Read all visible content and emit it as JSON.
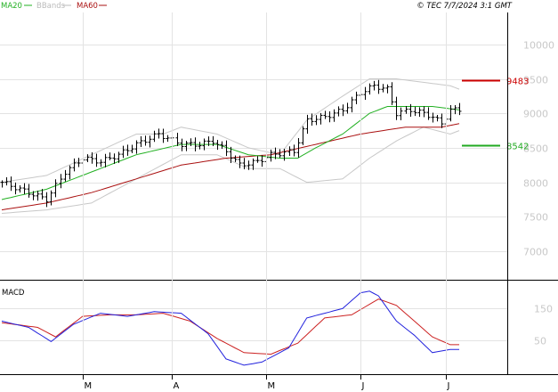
{
  "legend": [
    {
      "label": "MA20",
      "color": "#22b022"
    },
    {
      "label": "BBands",
      "color": "#bbbbbb"
    },
    {
      "label": "MA60",
      "color": "#aa1111"
    }
  ],
  "header_right": "© TEC 7/7/2024 3:1 GMT",
  "macd_title": "MACD",
  "colors": {
    "price_bar": "#000000",
    "ma20": "#22b022",
    "ma60": "#aa1111",
    "bbands": "#c8c8c8",
    "grid": "#e3e3e3",
    "resistance": "#cc0000",
    "support": "#22aa22",
    "macd": "#2222dd",
    "signal": "#cc2222",
    "axis_text": "#c8c8c8"
  },
  "chart_data": [
    {
      "type": "line",
      "title": "",
      "subtitle": "price (OHLC bars) with Bollinger Bands, MA20, MA60",
      "y_ticks": [
        "10000",
        "9500",
        "9000",
        "8500",
        "8000",
        "7500",
        "7000"
      ],
      "y_tick_values": [
        10000,
        9500,
        9000,
        8500,
        8000,
        7500,
        7000
      ],
      "ylim": [
        6600,
        10450
      ],
      "x_ticks": [
        "M",
        "A",
        "M",
        "J",
        "J"
      ],
      "x_tick_index": [
        18,
        38,
        59,
        80,
        99
      ],
      "count": 103,
      "grid": true,
      "levels": [
        {
          "label": "9483",
          "value": 9483,
          "color": "#cc0000"
        },
        {
          "label": "8542",
          "value": 8542,
          "color": "#22aa22"
        }
      ],
      "close_anchors": [
        [
          0,
          8000
        ],
        [
          6,
          7850
        ],
        [
          10,
          7750
        ],
        [
          14,
          8150
        ],
        [
          18,
          8350
        ],
        [
          22,
          8300
        ],
        [
          26,
          8400
        ],
        [
          30,
          8550
        ],
        [
          35,
          8700
        ],
        [
          40,
          8550
        ],
        [
          44,
          8550
        ],
        [
          47,
          8600
        ],
        [
          50,
          8450
        ],
        [
          53,
          8250
        ],
        [
          57,
          8300
        ],
        [
          60,
          8400
        ],
        [
          65,
          8450
        ],
        [
          68,
          8900
        ],
        [
          72,
          8950
        ],
        [
          76,
          9050
        ],
        [
          80,
          9300
        ],
        [
          83,
          9400
        ],
        [
          86,
          9350
        ],
        [
          88,
          9000
        ],
        [
          91,
          9050
        ],
        [
          94,
          9000
        ],
        [
          96,
          8950
        ],
        [
          98,
          8850
        ],
        [
          100,
          9050
        ],
        [
          102,
          9050
        ]
      ],
      "ma20_anchors": [
        [
          0,
          7750
        ],
        [
          10,
          7900
        ],
        [
          20,
          8150
        ],
        [
          30,
          8400
        ],
        [
          40,
          8550
        ],
        [
          48,
          8550
        ],
        [
          55,
          8400
        ],
        [
          62,
          8350
        ],
        [
          66,
          8350
        ],
        [
          70,
          8500
        ],
        [
          76,
          8700
        ],
        [
          82,
          9000
        ],
        [
          86,
          9100
        ],
        [
          90,
          9100
        ],
        [
          96,
          9100
        ],
        [
          102,
          9050
        ]
      ],
      "ma60_anchors": [
        [
          0,
          7600
        ],
        [
          10,
          7700
        ],
        [
          20,
          7850
        ],
        [
          30,
          8050
        ],
        [
          40,
          8250
        ],
        [
          50,
          8350
        ],
        [
          60,
          8400
        ],
        [
          70,
          8550
        ],
        [
          80,
          8700
        ],
        [
          90,
          8800
        ],
        [
          98,
          8800
        ],
        [
          102,
          8850
        ]
      ],
      "bb_upper_anchors": [
        [
          0,
          8000
        ],
        [
          10,
          8100
        ],
        [
          20,
          8400
        ],
        [
          30,
          8700
        ],
        [
          36,
          8700
        ],
        [
          40,
          8800
        ],
        [
          44,
          8750
        ],
        [
          48,
          8700
        ],
        [
          55,
          8500
        ],
        [
          62,
          8400
        ],
        [
          68,
          8900
        ],
        [
          76,
          9250
        ],
        [
          82,
          9500
        ],
        [
          88,
          9500
        ],
        [
          94,
          9450
        ],
        [
          100,
          9400
        ],
        [
          102,
          9350
        ]
      ],
      "bb_lower_anchors": [
        [
          0,
          7550
        ],
        [
          10,
          7600
        ],
        [
          20,
          7700
        ],
        [
          30,
          8050
        ],
        [
          40,
          8400
        ],
        [
          48,
          8400
        ],
        [
          55,
          8200
        ],
        [
          62,
          8200
        ],
        [
          68,
          8000
        ],
        [
          76,
          8050
        ],
        [
          82,
          8350
        ],
        [
          88,
          8600
        ],
        [
          94,
          8800
        ],
        [
          100,
          8700
        ],
        [
          102,
          8750
        ]
      ]
    },
    {
      "type": "line",
      "title": "MACD",
      "y_ticks": [
        "150",
        "50"
      ],
      "y_tick_values": [
        150,
        50
      ],
      "ylim": [
        -50,
        230
      ],
      "macd_anchors": [
        [
          0,
          110
        ],
        [
          6,
          90
        ],
        [
          11,
          45
        ],
        [
          16,
          100
        ],
        [
          22,
          135
        ],
        [
          28,
          125
        ],
        [
          34,
          140
        ],
        [
          40,
          135
        ],
        [
          46,
          70
        ],
        [
          50,
          -10
        ],
        [
          54,
          -30
        ],
        [
          58,
          -20
        ],
        [
          64,
          25
        ],
        [
          68,
          120
        ],
        [
          72,
          135
        ],
        [
          76,
          150
        ],
        [
          80,
          200
        ],
        [
          82,
          205
        ],
        [
          84,
          190
        ],
        [
          88,
          110
        ],
        [
          92,
          65
        ],
        [
          96,
          10
        ],
        [
          100,
          20
        ]
      ],
      "signal_anchors": [
        [
          0,
          105
        ],
        [
          8,
          90
        ],
        [
          12,
          60
        ],
        [
          18,
          125
        ],
        [
          24,
          130
        ],
        [
          30,
          130
        ],
        [
          36,
          135
        ],
        [
          42,
          110
        ],
        [
          48,
          55
        ],
        [
          54,
          10
        ],
        [
          60,
          5
        ],
        [
          66,
          40
        ],
        [
          72,
          120
        ],
        [
          78,
          130
        ],
        [
          84,
          180
        ],
        [
          88,
          160
        ],
        [
          92,
          110
        ],
        [
          96,
          60
        ],
        [
          100,
          35
        ]
      ]
    }
  ]
}
